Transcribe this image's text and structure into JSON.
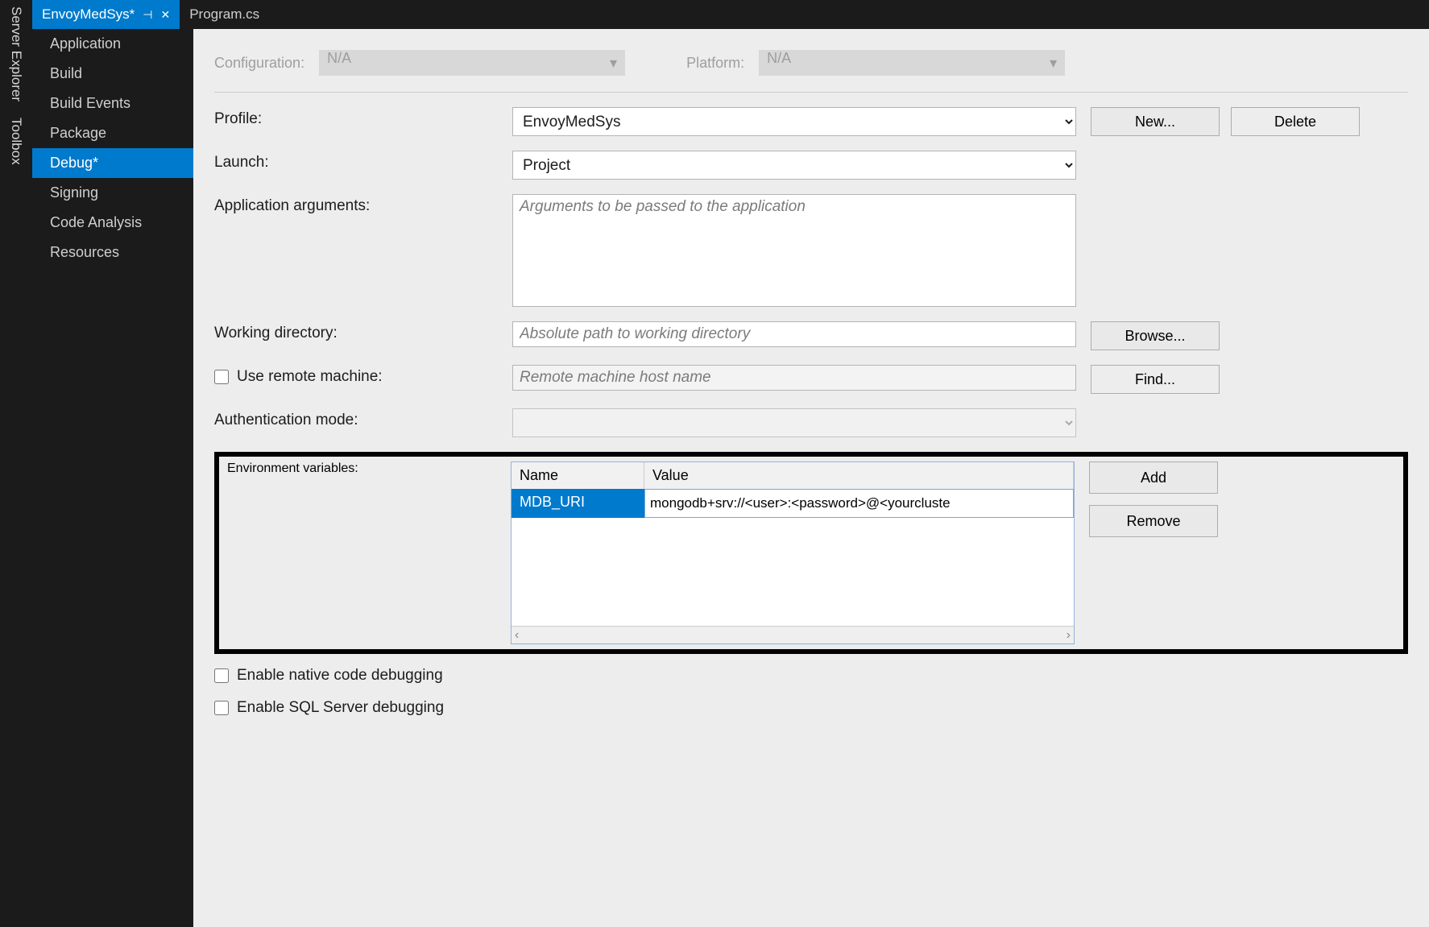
{
  "rail": {
    "serverExplorer": "Server Explorer",
    "toolbox": "Toolbox"
  },
  "tabs": {
    "active": "EnvoyMedSys*",
    "inactive": "Program.cs"
  },
  "nav": {
    "items": [
      "Application",
      "Build",
      "Build Events",
      "Package",
      "Debug*",
      "Signing",
      "Code Analysis",
      "Resources"
    ],
    "selectedIndex": 4
  },
  "header": {
    "configLabel": "Configuration:",
    "configValue": "N/A",
    "platformLabel": "Platform:",
    "platformValue": "N/A"
  },
  "form": {
    "profileLabel": "Profile:",
    "profileValue": "EnvoyMedSys",
    "newBtn": "New...",
    "deleteBtn": "Delete",
    "launchLabel": "Launch:",
    "launchValue": "Project",
    "argsLabel": "Application arguments:",
    "argsPlaceholder": "Arguments to be passed to the application",
    "workdirLabel": "Working directory:",
    "workdirPlaceholder": "Absolute path to working directory",
    "browseBtn": "Browse...",
    "remoteChk": "Use remote machine:",
    "remotePlaceholder": "Remote machine host name",
    "findBtn": "Find...",
    "authLabel": "Authentication mode:",
    "envLabel": "Environment variables:",
    "envHeaders": {
      "name": "Name",
      "value": "Value"
    },
    "env": [
      {
        "name": "MDB_URI",
        "value": "mongodb+srv://<user>:<password>@<yourcluste"
      }
    ],
    "addBtn": "Add",
    "removeBtn": "Remove",
    "nativeChk": "Enable native code debugging",
    "sqlChk": "Enable SQL Server debugging"
  }
}
